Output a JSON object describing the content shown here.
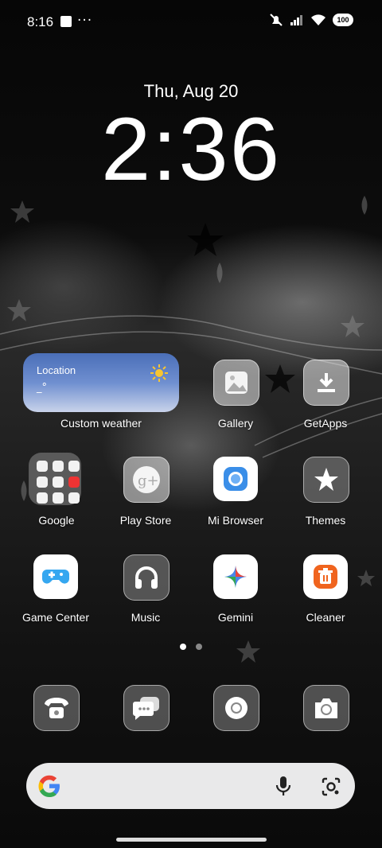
{
  "status_bar": {
    "time": "8:16",
    "dots": "···",
    "battery": "100"
  },
  "lockscreen": {
    "date": "Thu, Aug 20",
    "clock": "2:36"
  },
  "weather_widget": {
    "location": "Location",
    "temperature": "_°",
    "label": "Custom weather"
  },
  "apps": {
    "gallery": "Gallery",
    "getapps": "GetApps",
    "google": "Google",
    "play_store": "Play Store",
    "mi_browser": "Mi Browser",
    "themes": "Themes",
    "game_center": "Game Center",
    "music": "Music",
    "gemini": "Gemini",
    "cleaner": "Cleaner"
  },
  "page_indicator": {
    "total": 2,
    "current": 1
  },
  "dock": [
    "phone-icon",
    "messages-icon",
    "chrome-icon",
    "camera-icon"
  ],
  "search_bar": {
    "icons": [
      "google-g-icon",
      "mic-icon",
      "lens-icon"
    ]
  },
  "colors": {
    "cleaner_orange": "#f0641e",
    "weather_blue": "#4a6fb8"
  }
}
